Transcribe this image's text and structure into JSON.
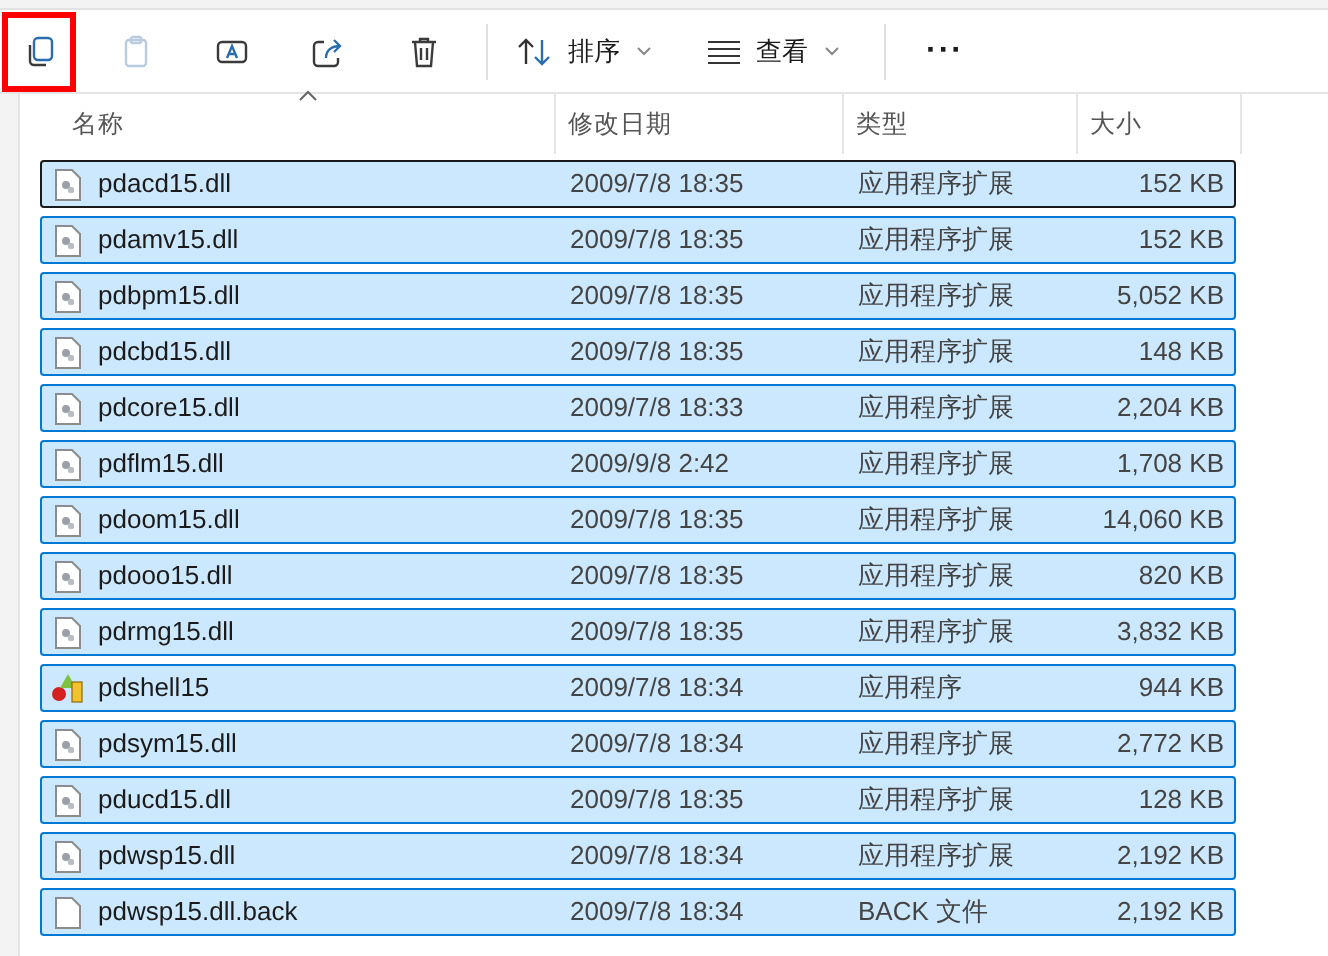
{
  "toolbar": {
    "buttons": [
      {
        "kind": "copy",
        "disabled": false,
        "highlighted": true
      },
      {
        "kind": "paste",
        "disabled": true,
        "highlighted": false
      },
      {
        "kind": "rename",
        "disabled": false,
        "highlighted": false
      },
      {
        "kind": "share",
        "disabled": false,
        "highlighted": false
      },
      {
        "kind": "delete",
        "disabled": false,
        "highlighted": false
      }
    ],
    "sort": {
      "label": "排序"
    },
    "view": {
      "label": "查看"
    },
    "more": "···"
  },
  "table": {
    "columns": [
      {
        "label": "名称",
        "sorted": true
      },
      {
        "label": "修改日期",
        "sorted": false
      },
      {
        "label": "类型",
        "sorted": false
      },
      {
        "label": "大小",
        "sorted": false
      }
    ],
    "rows": [
      {
        "kind": "dll",
        "name": "pdacd15.dll",
        "date": "2009/7/8 18:35",
        "type": "应用程序扩展",
        "size": "152 KB",
        "selected": true,
        "focused": true
      },
      {
        "kind": "dll",
        "name": "pdamv15.dll",
        "date": "2009/7/8 18:35",
        "type": "应用程序扩展",
        "size": "152 KB",
        "selected": true,
        "focused": false
      },
      {
        "kind": "dll",
        "name": "pdbpm15.dll",
        "date": "2009/7/8 18:35",
        "type": "应用程序扩展",
        "size": "5,052 KB",
        "selected": true,
        "focused": false
      },
      {
        "kind": "dll",
        "name": "pdcbd15.dll",
        "date": "2009/7/8 18:35",
        "type": "应用程序扩展",
        "size": "148 KB",
        "selected": true,
        "focused": false
      },
      {
        "kind": "dll",
        "name": "pdcore15.dll",
        "date": "2009/7/8 18:33",
        "type": "应用程序扩展",
        "size": "2,204 KB",
        "selected": true,
        "focused": false
      },
      {
        "kind": "dll",
        "name": "pdflm15.dll",
        "date": "2009/9/8 2:42",
        "type": "应用程序扩展",
        "size": "1,708 KB",
        "selected": true,
        "focused": false
      },
      {
        "kind": "dll",
        "name": "pdoom15.dll",
        "date": "2009/7/8 18:35",
        "type": "应用程序扩展",
        "size": "14,060 KB",
        "selected": true,
        "focused": false
      },
      {
        "kind": "dll",
        "name": "pdooo15.dll",
        "date": "2009/7/8 18:35",
        "type": "应用程序扩展",
        "size": "820 KB",
        "selected": true,
        "focused": false
      },
      {
        "kind": "dll",
        "name": "pdrmg15.dll",
        "date": "2009/7/8 18:35",
        "type": "应用程序扩展",
        "size": "3,832 KB",
        "selected": true,
        "focused": false
      },
      {
        "kind": "app",
        "name": "pdshell15",
        "date": "2009/7/8 18:34",
        "type": "应用程序",
        "size": "944 KB",
        "selected": true,
        "focused": false
      },
      {
        "kind": "dll",
        "name": "pdsym15.dll",
        "date": "2009/7/8 18:34",
        "type": "应用程序扩展",
        "size": "2,772 KB",
        "selected": true,
        "focused": false
      },
      {
        "kind": "dll",
        "name": "pducd15.dll",
        "date": "2009/7/8 18:35",
        "type": "应用程序扩展",
        "size": "128 KB",
        "selected": true,
        "focused": false
      },
      {
        "kind": "dll",
        "name": "pdwsp15.dll",
        "date": "2009/7/8 18:34",
        "type": "应用程序扩展",
        "size": "2,192 KB",
        "selected": true,
        "focused": false
      },
      {
        "kind": "file",
        "name": "pdwsp15.dll.back",
        "date": "2009/7/8 18:34",
        "type": "BACK 文件",
        "size": "2,192 KB",
        "selected": true,
        "focused": false
      }
    ]
  }
}
